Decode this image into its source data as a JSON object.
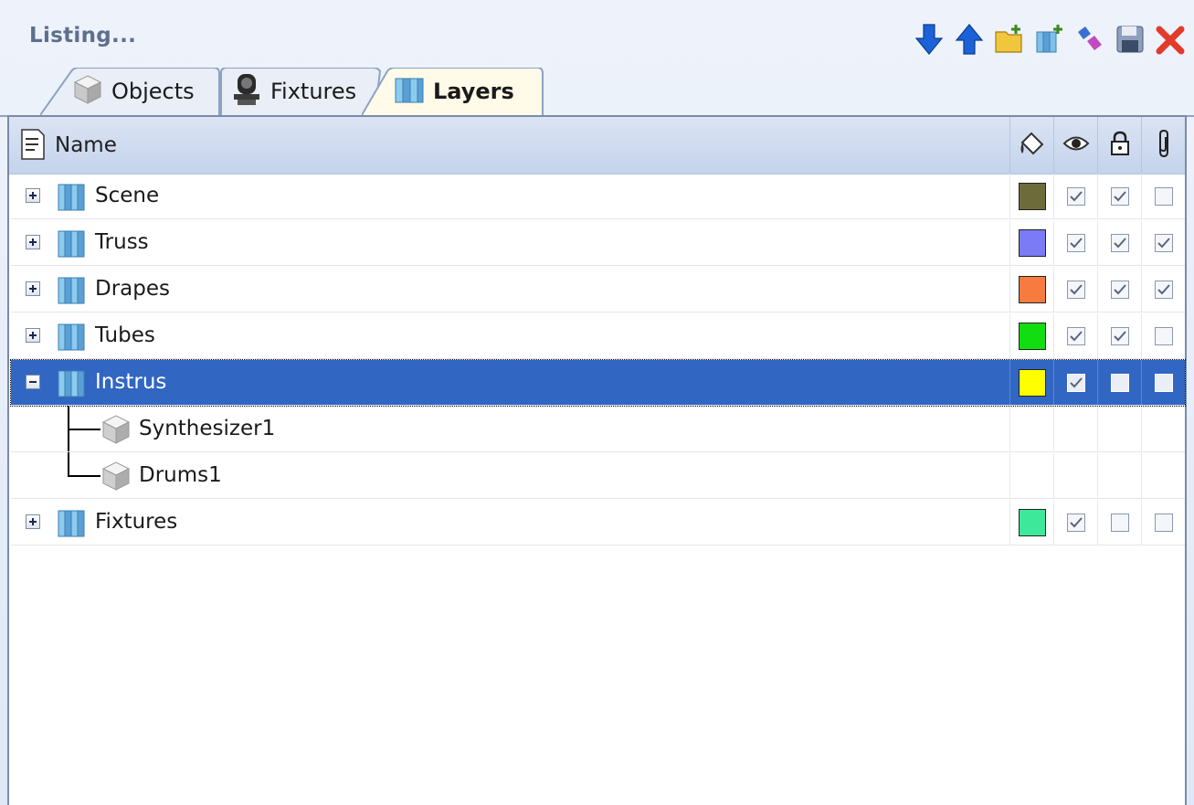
{
  "header": {
    "title": "Listing...",
    "toolbar": [
      {
        "name": "move-down-icon",
        "color": "#1b62d8"
      },
      {
        "name": "move-up-icon",
        "color": "#1b62d8"
      },
      {
        "name": "new-folder-icon",
        "color": "#f0c63c"
      },
      {
        "name": "new-layer-icon",
        "color": "#5aa0d6"
      },
      {
        "name": "merge-icon",
        "color": "#c24ac0"
      },
      {
        "name": "save-icon",
        "color": "#5c6f8c"
      },
      {
        "name": "close-icon",
        "color": "#e23a2c"
      }
    ]
  },
  "tabs": [
    {
      "label": "Objects",
      "icon": "cube-icon",
      "active": false
    },
    {
      "label": "Fixtures",
      "icon": "moving-head-icon",
      "active": false
    },
    {
      "label": "Layers",
      "icon": "layer-icon",
      "active": true
    }
  ],
  "columns": {
    "name": "Name",
    "icons": [
      "paint-bucket-icon",
      "eye-icon",
      "lock-icon",
      "paperclip-icon"
    ]
  },
  "layers": [
    {
      "label": "Scene",
      "color": "#6e6b3b",
      "visible": true,
      "locked": true,
      "linked": false,
      "expanded": false,
      "selected": false
    },
    {
      "label": "Truss",
      "color": "#7b7bf5",
      "visible": true,
      "locked": true,
      "linked": true,
      "expanded": false,
      "selected": false
    },
    {
      "label": "Drapes",
      "color": "#f77a3f",
      "visible": true,
      "locked": true,
      "linked": true,
      "expanded": false,
      "selected": false
    },
    {
      "label": "Tubes",
      "color": "#11dd11",
      "visible": true,
      "locked": true,
      "linked": false,
      "expanded": false,
      "selected": false
    },
    {
      "label": "Instrus",
      "color": "#ffff00",
      "visible": true,
      "locked": false,
      "linked": false,
      "expanded": true,
      "selected": true,
      "children": [
        {
          "label": "Synthesizer1"
        },
        {
          "label": "Drums1"
        }
      ]
    },
    {
      "label": "Fixtures",
      "color": "#3ee89a",
      "visible": true,
      "locked": false,
      "linked": false,
      "expanded": false,
      "selected": false
    }
  ]
}
